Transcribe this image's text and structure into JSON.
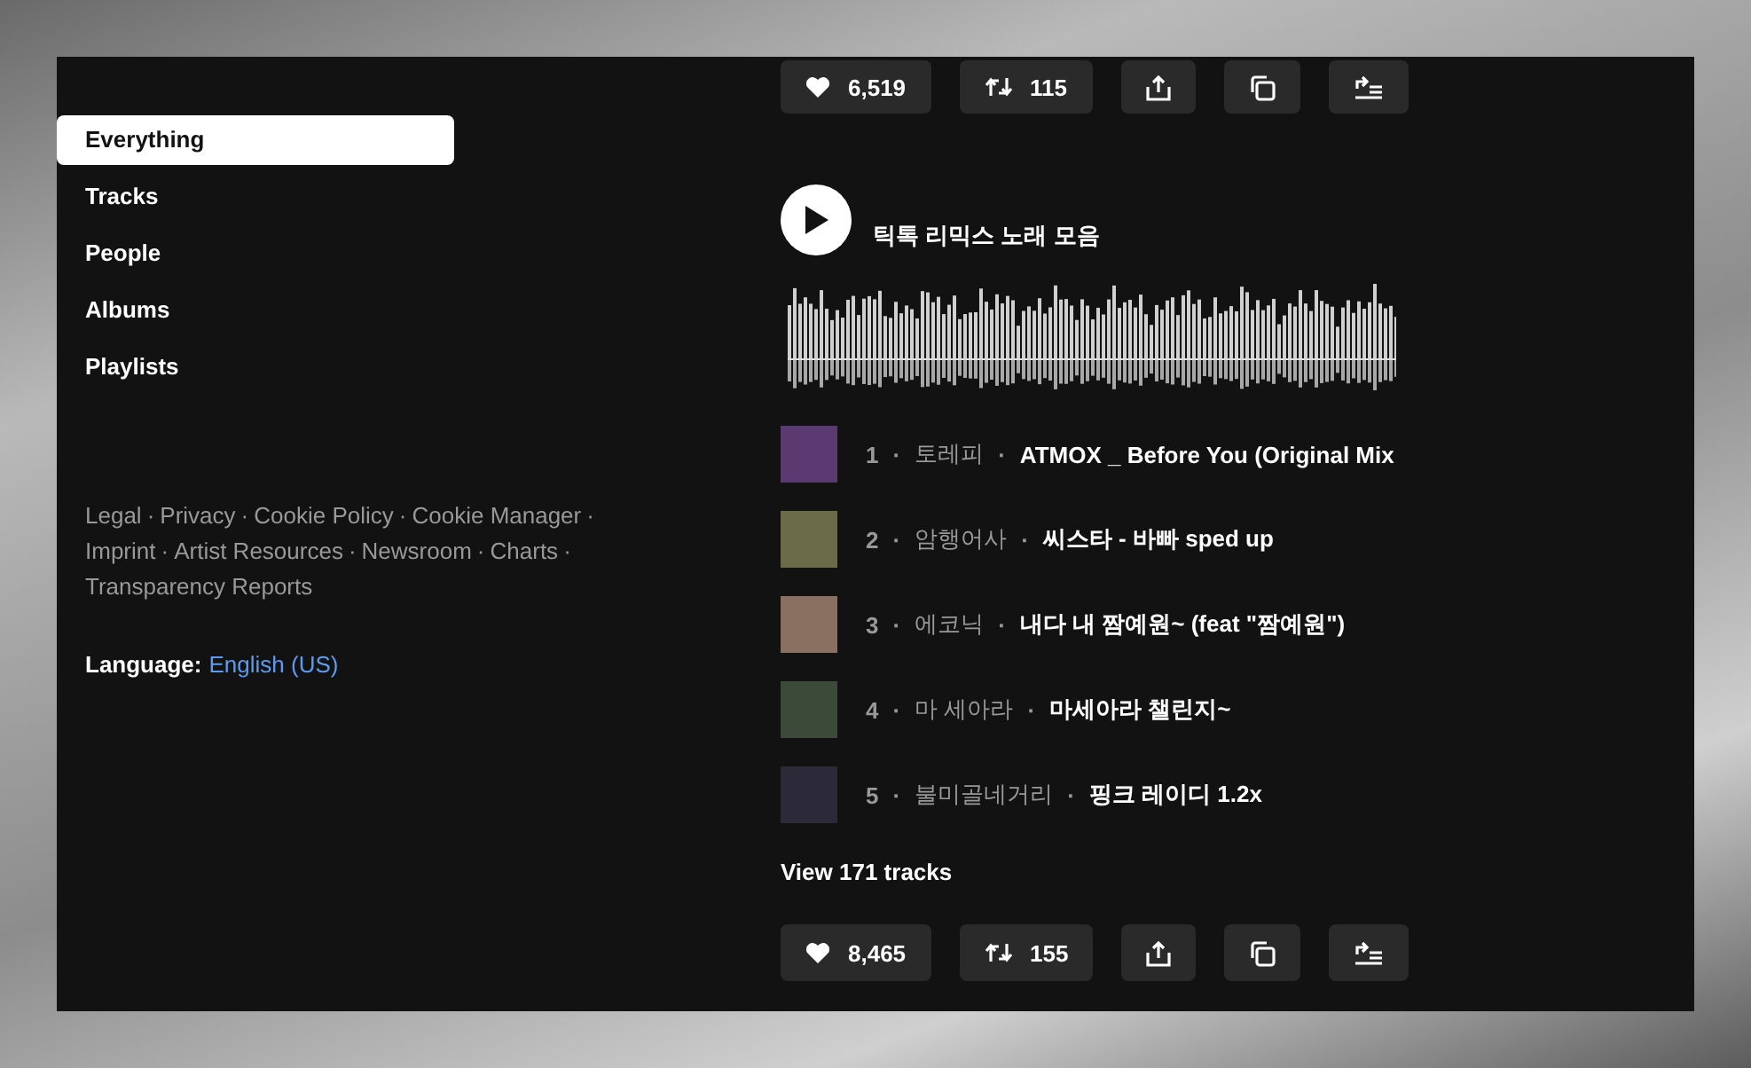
{
  "sidebar": {
    "items": [
      {
        "label": "Everything",
        "selected": true
      },
      {
        "label": "Tracks",
        "selected": false
      },
      {
        "label": "People",
        "selected": false
      },
      {
        "label": "Albums",
        "selected": false
      },
      {
        "label": "Playlists",
        "selected": false
      }
    ]
  },
  "footer": {
    "separator": "·",
    "links": [
      "Legal",
      "Privacy",
      "Cookie Policy",
      "Cookie Manager",
      "Imprint",
      "Artist Resources",
      "Newsroom",
      "Charts",
      "Transparency Reports"
    ]
  },
  "language": {
    "label": "Language:",
    "value": "English (US)"
  },
  "playlist": {
    "top_actions": {
      "likes": "6,519",
      "reposts": "115"
    },
    "title": "틱톡 리믹스 노래 모음",
    "separator": "·",
    "tracks": [
      {
        "number": "1",
        "artist": "토레피",
        "title": "ATMOX _ Before You (Original Mix"
      },
      {
        "number": "2",
        "artist": "암행어사",
        "title": "씨스타 - 바빠 sped up"
      },
      {
        "number": "3",
        "artist": "에코닉",
        "title": "내다 내 짬예원~ (feat \"짬예원\")"
      },
      {
        "number": "4",
        "artist": "마 세아라",
        "title": "마세아라 챌린지~"
      },
      {
        "number": "5",
        "artist": "불미골네거리",
        "title": "핑크 레이디 1.2x"
      }
    ],
    "view_all": "View 171 tracks",
    "bottom_actions": {
      "likes": "8,465",
      "reposts": "155"
    }
  }
}
